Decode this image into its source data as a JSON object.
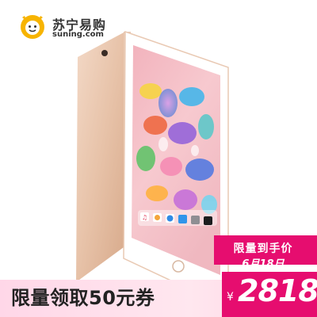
{
  "brand": {
    "name_cn": "苏宁易购",
    "domain": "suning.com",
    "logo_color": "#f7b400"
  },
  "promo": {
    "coupon_text": "限量领取50元券",
    "badge_title": "限量到手价",
    "badge_date": "6月18日",
    "currency": "¥",
    "price": "2818",
    "accent_color": "#e60d6f"
  },
  "product": {
    "description": "gold tablet product photo with colorful wallpaper",
    "dock_icons": [
      "music-icon",
      "photos-icon",
      "safari-icon",
      "mail-icon",
      "settings-icon",
      "apps-icon"
    ]
  }
}
